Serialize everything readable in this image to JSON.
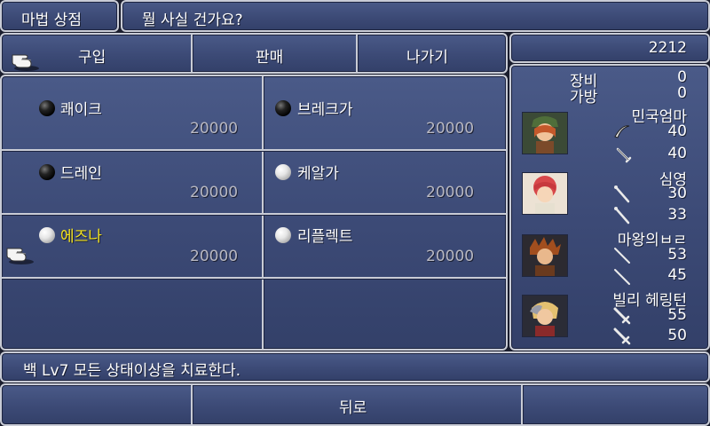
{
  "shop": {
    "title": "마법 상점",
    "prompt": "뭘 사실 건가요?"
  },
  "menu": {
    "buy": "구입",
    "sell": "판매",
    "exit": "나가기"
  },
  "gil": "2212",
  "items": [
    {
      "name": "쾌이크",
      "price": "20000",
      "orb": "black"
    },
    {
      "name": "브레크가",
      "price": "20000",
      "orb": "black"
    },
    {
      "name": "드레인",
      "price": "20000",
      "orb": "black"
    },
    {
      "name": "케알가",
      "price": "20000",
      "orb": "white"
    },
    {
      "name": "에즈나",
      "price": "20000",
      "orb": "white",
      "selected": true
    },
    {
      "name": "리플렉트",
      "price": "20000",
      "orb": "white"
    }
  ],
  "stats": {
    "equip_label": "장비",
    "equip_value": "0",
    "carry_label": "가방",
    "carry_value": "0"
  },
  "party": [
    {
      "name": "민국엄마",
      "v1": "40",
      "v2": "40",
      "icon1": "boomerang-icon",
      "icon2": "dagger-icon"
    },
    {
      "name": "심영",
      "v1": "30",
      "v2": "33",
      "icon1": "rod-icon",
      "icon2": "rod-icon"
    },
    {
      "name": "마왕의ㅂㄹ",
      "v1": "53",
      "v2": "45",
      "icon1": "staff-icon",
      "icon2": "staff-icon"
    },
    {
      "name": "빌리 헤링턴",
      "v1": "55",
      "v2": "50",
      "icon1": "sword-icon",
      "icon2": "sword-icon"
    }
  ],
  "description": "백 Lv7 모든 상태이상을 치료한다.",
  "footer": {
    "back": "뒤로"
  },
  "colors": {
    "panel": "#3c4a76",
    "border": "#c9ccd6",
    "selected_text": "#f5e41c",
    "price_text": "#b8b8c2"
  }
}
